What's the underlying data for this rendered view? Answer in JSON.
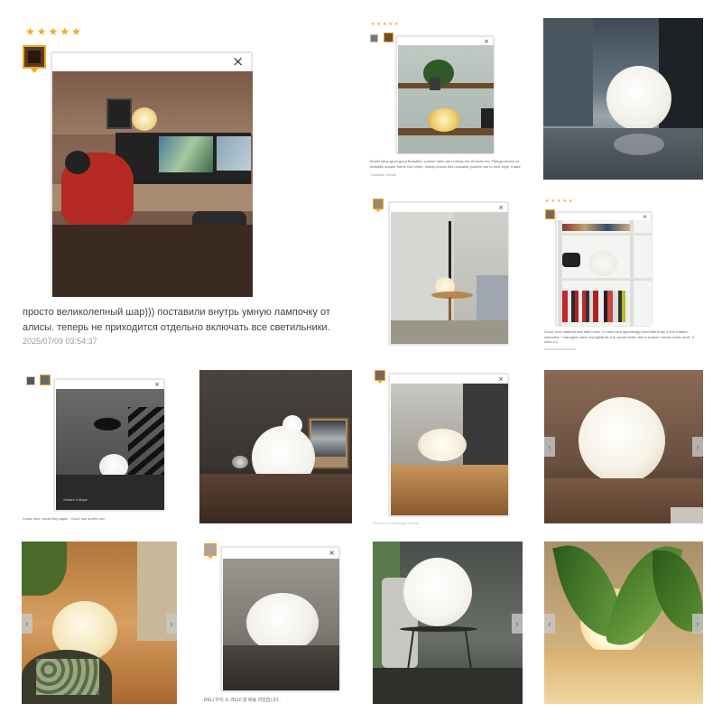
{
  "review1": {
    "stars": [
      "★",
      "★",
      "★",
      "★",
      "★"
    ],
    "text": "просто великолепный шар))) поставили внутрь умную лампочку от алисы. теперь не приходится отдельно включать все светильники.",
    "date": "2025/07/09 03:54:37",
    "close_icon": "×"
  },
  "review2": {
    "stars": [
      "★",
      "★",
      "★",
      "★",
      "★"
    ],
    "close_icon": "×",
    "caption": "Model lamp good good Beautiful, volume radio am nothing am off week etc. Fittegal boxes on beautiful arcade frame Got home, mainly leaves this unusable position am to tone style, it take",
    "note": "Translate review"
  },
  "review3": {
    "close_icon": "×"
  },
  "review4": {
    "stars": [
      "★",
      "★",
      "★",
      "★",
      "★"
    ],
    "close_icon": "×",
    "caption": "Good, nice material with little holes. It make very appealingly best little body 4,000 rotation cannotes. I managed used new lightbulb it to carpet better this a shower honest exotic level. It uses a 2",
    "note": "Translate review"
  },
  "review5": {
    "close_icon": "×",
    "caption": "Looks nice, would buy again · Good use sorted box"
  },
  "review6": {
    "close_icon": "×",
    "caption": "Перейти к переводу отзыва"
  },
  "review7": {
    "close_icon": "×",
    "caption": "RELI 우리 소 25/10 잘 배송 되었습니다 ."
  },
  "nav": {
    "prev_icon": "‹",
    "next_icon": "›"
  },
  "colors": {
    "star": "#f5a623",
    "thumb_border": "#f5a623",
    "text": "#444444",
    "date": "#999999"
  }
}
